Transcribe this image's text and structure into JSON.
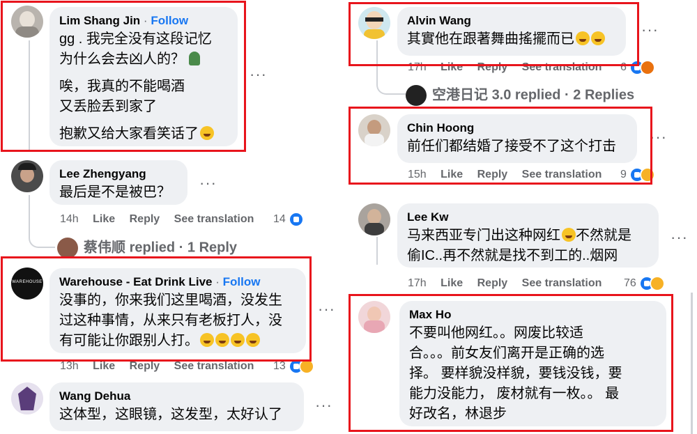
{
  "comments": {
    "lim": {
      "name": "Lim Shang Jin",
      "separator": "·",
      "follow": "Follow",
      "lines": [
        "gg . 我完全没有这段记忆",
        "为什么会去凶人的？",
        "唉，我真的不能喝酒",
        "又丢脸丢到家了",
        "抱歉又给大家看笑话了"
      ]
    },
    "lee_zhengyang": {
      "name": "Lee Zhengyang",
      "lines": [
        "最后是不是被巴？"
      ],
      "time": "14h",
      "like": "Like",
      "reply": "Reply",
      "translate": "See translation",
      "count": "14"
    },
    "cai_replied": {
      "author": "蔡伟顺",
      "text": "replied · 1 Reply"
    },
    "warehouse": {
      "name": "Warehouse - Eat Drink Live",
      "separator": "·",
      "follow": "Follow",
      "avatar_text": "WAREHOUSE",
      "lines": [
        "没事的，你来我们这里喝酒，没发生",
        "过这种事情，从来只有老板打人，没",
        "有可能让你跟别人打。"
      ],
      "time": "13h",
      "like": "Like",
      "reply": "Reply",
      "translate": "See translation",
      "count": "13"
    },
    "wang": {
      "name": "Wang Dehua",
      "lines": [
        "这体型，这眼镜，这发型，太好认了"
      ]
    },
    "alvin": {
      "name": "Alvin Wang",
      "lines": [
        "其實他在跟著舞曲搖擺而已"
      ],
      "time": "17h",
      "like": "Like",
      "reply": "Reply",
      "translate": "See translation",
      "count": "6"
    },
    "kong_replied": {
      "author": "空港日记",
      "text": "3.0 replied · 2 Replies"
    },
    "chin": {
      "name": "Chin Hoong",
      "lines": [
        "前任们都结婚了接受不了这个打击"
      ],
      "time": "15h",
      "like": "Like",
      "reply": "Reply",
      "translate": "See translation",
      "count": "9"
    },
    "lee_kw": {
      "name": "Lee Kw",
      "lines": [
        "马来西亚专门出这种网红",
        "不然就是",
        "偷IC..再不然就是找不到工的..烟网"
      ],
      "time": "17h",
      "like": "Like",
      "reply": "Reply",
      "translate": "See translation",
      "count": "76"
    },
    "max": {
      "name": "Max Ho",
      "lines": [
        "不要叫他网红。。网废比较适",
        "合。。。前女友们离开是正确的选",
        "择。 要样貌没样貌，要钱没钱，要",
        "能力没能力， 废材就有一枚。。 最",
        "好改名，林退步"
      ]
    }
  },
  "more_label": "···",
  "colors": {
    "accent": "#1877f2",
    "highlight": "#e8141c",
    "bubble": "#eef0f3",
    "meta": "#65676b"
  },
  "icons": [
    "like-icon",
    "haha-icon",
    "angry-icon",
    "more-icon"
  ]
}
